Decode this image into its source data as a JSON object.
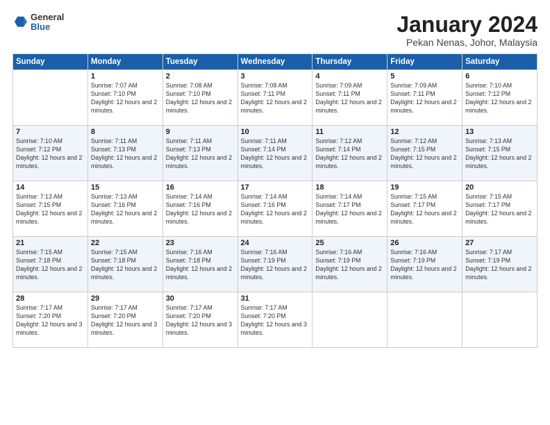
{
  "logo": {
    "general": "General",
    "blue": "Blue"
  },
  "title": {
    "month_year": "January 2024",
    "location": "Pekan Nenas, Johor, Malaysia"
  },
  "header": {
    "days": [
      "Sunday",
      "Monday",
      "Tuesday",
      "Wednesday",
      "Thursday",
      "Friday",
      "Saturday"
    ]
  },
  "weeks": [
    [
      {
        "num": "",
        "empty": true
      },
      {
        "num": "1",
        "sunrise": "7:07 AM",
        "sunset": "7:10 PM",
        "daylight": "12 hours and 2 minutes."
      },
      {
        "num": "2",
        "sunrise": "7:08 AM",
        "sunset": "7:10 PM",
        "daylight": "12 hours and 2 minutes."
      },
      {
        "num": "3",
        "sunrise": "7:08 AM",
        "sunset": "7:11 PM",
        "daylight": "12 hours and 2 minutes."
      },
      {
        "num": "4",
        "sunrise": "7:09 AM",
        "sunset": "7:11 PM",
        "daylight": "12 hours and 2 minutes."
      },
      {
        "num": "5",
        "sunrise": "7:09 AM",
        "sunset": "7:11 PM",
        "daylight": "12 hours and 2 minutes."
      },
      {
        "num": "6",
        "sunrise": "7:10 AM",
        "sunset": "7:12 PM",
        "daylight": "12 hours and 2 minutes."
      }
    ],
    [
      {
        "num": "7",
        "sunrise": "7:10 AM",
        "sunset": "7:12 PM",
        "daylight": "12 hours and 2 minutes."
      },
      {
        "num": "8",
        "sunrise": "7:11 AM",
        "sunset": "7:13 PM",
        "daylight": "12 hours and 2 minutes."
      },
      {
        "num": "9",
        "sunrise": "7:11 AM",
        "sunset": "7:13 PM",
        "daylight": "12 hours and 2 minutes."
      },
      {
        "num": "10",
        "sunrise": "7:11 AM",
        "sunset": "7:14 PM",
        "daylight": "12 hours and 2 minutes."
      },
      {
        "num": "11",
        "sunrise": "7:12 AM",
        "sunset": "7:14 PM",
        "daylight": "12 hours and 2 minutes."
      },
      {
        "num": "12",
        "sunrise": "7:12 AM",
        "sunset": "7:15 PM",
        "daylight": "12 hours and 2 minutes."
      },
      {
        "num": "13",
        "sunrise": "7:13 AM",
        "sunset": "7:15 PM",
        "daylight": "12 hours and 2 minutes."
      }
    ],
    [
      {
        "num": "14",
        "sunrise": "7:13 AM",
        "sunset": "7:15 PM",
        "daylight": "12 hours and 2 minutes."
      },
      {
        "num": "15",
        "sunrise": "7:13 AM",
        "sunset": "7:16 PM",
        "daylight": "12 hours and 2 minutes."
      },
      {
        "num": "16",
        "sunrise": "7:14 AM",
        "sunset": "7:16 PM",
        "daylight": "12 hours and 2 minutes."
      },
      {
        "num": "17",
        "sunrise": "7:14 AM",
        "sunset": "7:16 PM",
        "daylight": "12 hours and 2 minutes."
      },
      {
        "num": "18",
        "sunrise": "7:14 AM",
        "sunset": "7:17 PM",
        "daylight": "12 hours and 2 minutes."
      },
      {
        "num": "19",
        "sunrise": "7:15 AM",
        "sunset": "7:17 PM",
        "daylight": "12 hours and 2 minutes."
      },
      {
        "num": "20",
        "sunrise": "7:15 AM",
        "sunset": "7:17 PM",
        "daylight": "12 hours and 2 minutes."
      }
    ],
    [
      {
        "num": "21",
        "sunrise": "7:15 AM",
        "sunset": "7:18 PM",
        "daylight": "12 hours and 2 minutes."
      },
      {
        "num": "22",
        "sunrise": "7:15 AM",
        "sunset": "7:18 PM",
        "daylight": "12 hours and 2 minutes."
      },
      {
        "num": "23",
        "sunrise": "7:16 AM",
        "sunset": "7:18 PM",
        "daylight": "12 hours and 2 minutes."
      },
      {
        "num": "24",
        "sunrise": "7:16 AM",
        "sunset": "7:19 PM",
        "daylight": "12 hours and 2 minutes."
      },
      {
        "num": "25",
        "sunrise": "7:16 AM",
        "sunset": "7:19 PM",
        "daylight": "12 hours and 2 minutes."
      },
      {
        "num": "26",
        "sunrise": "7:16 AM",
        "sunset": "7:19 PM",
        "daylight": "12 hours and 2 minutes."
      },
      {
        "num": "27",
        "sunrise": "7:17 AM",
        "sunset": "7:19 PM",
        "daylight": "12 hours and 2 minutes."
      }
    ],
    [
      {
        "num": "28",
        "sunrise": "7:17 AM",
        "sunset": "7:20 PM",
        "daylight": "12 hours and 3 minutes."
      },
      {
        "num": "29",
        "sunrise": "7:17 AM",
        "sunset": "7:20 PM",
        "daylight": "12 hours and 3 minutes."
      },
      {
        "num": "30",
        "sunrise": "7:17 AM",
        "sunset": "7:20 PM",
        "daylight": "12 hours and 3 minutes."
      },
      {
        "num": "31",
        "sunrise": "7:17 AM",
        "sunset": "7:20 PM",
        "daylight": "12 hours and 3 minutes."
      },
      {
        "num": "",
        "empty": true
      },
      {
        "num": "",
        "empty": true
      },
      {
        "num": "",
        "empty": true
      }
    ]
  ],
  "labels": {
    "sunrise": "Sunrise:",
    "sunset": "Sunset:",
    "daylight": "Daylight:"
  }
}
